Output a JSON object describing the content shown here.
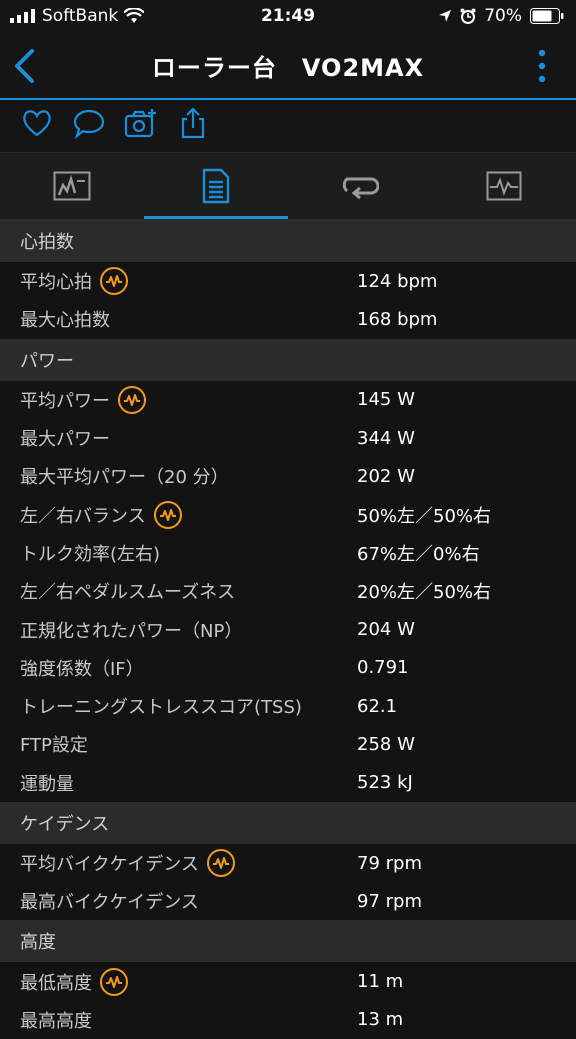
{
  "status_bar": {
    "carrier": "SoftBank",
    "time": "21:49",
    "battery": "70%"
  },
  "nav": {
    "title": "ローラー台　VO2MAX"
  },
  "sections": [
    {
      "title": "心拍数",
      "rows": [
        {
          "label": "平均心拍",
          "value": "124 bpm",
          "badge": true
        },
        {
          "label": "最大心拍数",
          "value": "168 bpm",
          "badge": false
        }
      ]
    },
    {
      "title": "パワー",
      "rows": [
        {
          "label": "平均パワー",
          "value": "145 W",
          "badge": true
        },
        {
          "label": "最大パワー",
          "value": "344 W",
          "badge": false
        },
        {
          "label": "最大平均パワー（20 分）",
          "value": "202 W",
          "badge": false
        },
        {
          "label": "左／右バランス",
          "value": "50%左／50%右",
          "badge": true
        },
        {
          "label": "トルク効率(左右)",
          "value": "67%左／0%右",
          "badge": false
        },
        {
          "label": "左／右ペダルスムーズネス",
          "value": "20%左／50%右",
          "badge": false
        },
        {
          "label": "正規化されたパワー（NP）",
          "value": "204 W",
          "badge": false
        },
        {
          "label": "強度係数（IF）",
          "value": "0.791",
          "badge": false
        },
        {
          "label": "トレーニングストレススコア(TSS)",
          "value": "62.1",
          "badge": false
        },
        {
          "label": "FTP設定",
          "value": "258 W",
          "badge": false
        },
        {
          "label": "運動量",
          "value": "523 kJ",
          "badge": false
        }
      ]
    },
    {
      "title": "ケイデンス",
      "rows": [
        {
          "label": "平均バイクケイデンス",
          "value": "79 rpm",
          "badge": true
        },
        {
          "label": "最高バイクケイデンス",
          "value": "97 rpm",
          "badge": false
        }
      ]
    },
    {
      "title": "高度",
      "rows": [
        {
          "label": "最低高度",
          "value": "11 m",
          "badge": true
        },
        {
          "label": "最高高度",
          "value": "13 m",
          "badge": false
        }
      ]
    }
  ],
  "colors": {
    "accent": "#1a8ed8",
    "badge": "#f39a1c"
  }
}
